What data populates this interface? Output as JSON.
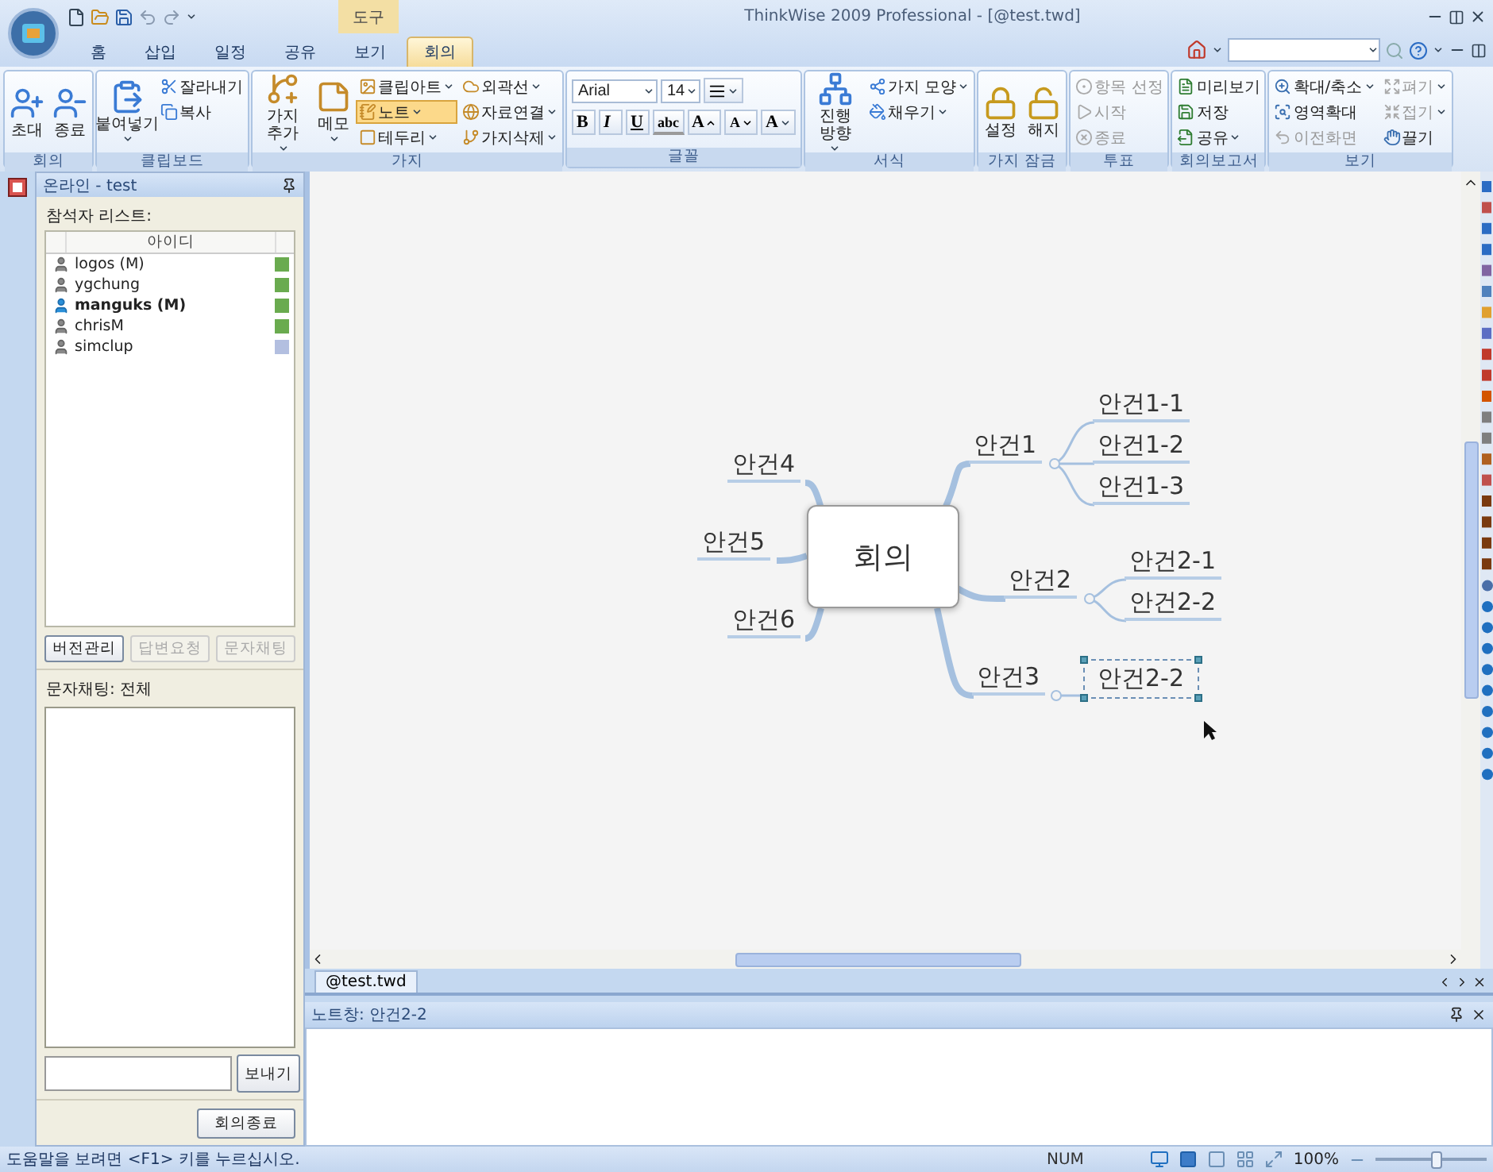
{
  "app": {
    "title": "ThinkWise 2009 Professional - [@test.twd]",
    "contextual_tab": "도구"
  },
  "tabs": [
    {
      "label": "홈",
      "selected": false
    },
    {
      "label": "삽입",
      "selected": false
    },
    {
      "label": "일정",
      "selected": false
    },
    {
      "label": "공유",
      "selected": false
    },
    {
      "label": "보기",
      "selected": false
    },
    {
      "label": "회의",
      "selected": true
    }
  ],
  "ribbon": [
    {
      "label": "회의",
      "kind": "buttons",
      "items": [
        {
          "kind": "large",
          "label": "초대",
          "dropdown": false,
          "disabled": false,
          "active": false
        },
        {
          "kind": "large",
          "label": "종료",
          "dropdown": false,
          "disabled": false,
          "active": false
        }
      ]
    },
    {
      "label": "클립보드",
      "kind": "buttons",
      "items": [
        {
          "kind": "large",
          "label": "붙여넣기",
          "dropdown": true,
          "disabled": false,
          "active": false
        },
        {
          "kind": "small",
          "label": "잘라내기",
          "dropdown": false,
          "disabled": false,
          "active": false
        },
        {
          "kind": "small",
          "label": "복사",
          "dropdown": false,
          "disabled": false,
          "active": false
        }
      ]
    },
    {
      "label": "가지",
      "kind": "buttons",
      "items": [
        {
          "kind": "large",
          "label": "가지 추가",
          "dropdown": true,
          "disabled": false,
          "active": false
        },
        {
          "kind": "large",
          "label": "메모",
          "dropdown": true,
          "disabled": false,
          "active": false
        },
        {
          "kind": "small",
          "label": "클립아트",
          "dropdown": true,
          "disabled": false,
          "active": false
        },
        {
          "kind": "small",
          "label": "노트",
          "dropdown": true,
          "disabled": false,
          "active": true
        },
        {
          "kind": "small",
          "label": "테두리",
          "dropdown": true,
          "disabled": false,
          "active": false
        },
        {
          "kind": "small",
          "label": "외곽선",
          "dropdown": true,
          "disabled": false,
          "active": false
        },
        {
          "kind": "small",
          "label": "자료연결",
          "dropdown": true,
          "disabled": false,
          "active": false
        },
        {
          "kind": "small",
          "label": "가지삭제",
          "dropdown": true,
          "disabled": false,
          "active": false
        }
      ]
    },
    {
      "label": "글꼴",
      "kind": "font",
      "font": "Arial",
      "size": "14",
      "format_buttons": [
        {
          "label": "B",
          "kind": "bold"
        },
        {
          "label": "I",
          "kind": "italic"
        },
        {
          "label": "U",
          "kind": "underline"
        },
        {
          "label": "abc",
          "kind": "strike"
        },
        {
          "label": "A",
          "kind": "grow"
        },
        {
          "label": "A",
          "kind": "shrink"
        },
        {
          "label": "A",
          "kind": "color"
        }
      ]
    },
    {
      "label": "서식",
      "kind": "buttons",
      "items": [
        {
          "kind": "large",
          "label": "진행 방향",
          "dropdown": true,
          "disabled": false,
          "active": false
        },
        {
          "kind": "small",
          "label": "가지 모양",
          "dropdown": true,
          "disabled": false,
          "active": false
        },
        {
          "kind": "small",
          "label": "채우기",
          "dropdown": true,
          "disabled": false,
          "active": false
        }
      ]
    },
    {
      "label": "가지 잠금",
      "kind": "buttons",
      "items": [
        {
          "kind": "large",
          "label": "설정",
          "dropdown": false,
          "disabled": false,
          "active": false
        },
        {
          "kind": "large",
          "label": "해지",
          "dropdown": false,
          "disabled": false,
          "active": false
        }
      ]
    },
    {
      "label": "투표",
      "kind": "buttons",
      "items": [
        {
          "kind": "small",
          "label": "항목 선정",
          "dropdown": false,
          "disabled": true,
          "active": false
        },
        {
          "kind": "small",
          "label": "시작",
          "dropdown": false,
          "disabled": true,
          "active": false
        },
        {
          "kind": "small",
          "label": "종료",
          "dropdown": false,
          "disabled": true,
          "active": false
        }
      ]
    },
    {
      "label": "회의보고서",
      "kind": "buttons",
      "items": [
        {
          "kind": "small",
          "label": "미리보기",
          "dropdown": false,
          "disabled": false,
          "active": false
        },
        {
          "kind": "small",
          "label": "저장",
          "dropdown": false,
          "disabled": false,
          "active": false
        },
        {
          "kind": "small",
          "label": "공유",
          "dropdown": true,
          "disabled": false,
          "active": false
        }
      ]
    },
    {
      "label": "보기",
      "kind": "buttons",
      "items": [
        {
          "kind": "small",
          "label": "확대/축소",
          "dropdown": true,
          "disabled": false,
          "active": false
        },
        {
          "kind": "small",
          "label": "영역확대",
          "dropdown": false,
          "disabled": false,
          "active": false
        },
        {
          "kind": "small",
          "label": "이전화면",
          "dropdown": false,
          "disabled": true,
          "active": false
        },
        {
          "kind": "small",
          "label": "펴기",
          "dropdown": true,
          "disabled": true,
          "active": false
        },
        {
          "kind": "small",
          "label": "접기",
          "dropdown": true,
          "disabled": true,
          "active": false
        },
        {
          "kind": "small",
          "label": "끌기",
          "dropdown": false,
          "disabled": false,
          "active": false
        }
      ]
    }
  ],
  "online_panel": {
    "title": "온라인 - test",
    "participants_label": "참석자 리스트:",
    "column": "아이디",
    "participants": [
      {
        "name": "logos (M)",
        "current": false,
        "color": "#6aab4f"
      },
      {
        "name": "ygchung",
        "current": false,
        "color": "#6aab4f"
      },
      {
        "name": "manguks (M)",
        "current": true,
        "color": "#6aab4f"
      },
      {
        "name": "chrisM",
        "current": false,
        "color": "#6aab4f"
      },
      {
        "name": "simclup",
        "current": false,
        "color": "#b3bfe0"
      }
    ],
    "buttons": [
      {
        "label": "버전관리",
        "disabled": false
      },
      {
        "label": "답변요청",
        "disabled": true
      },
      {
        "label": "문자채팅",
        "disabled": true
      }
    ],
    "chat_label": "문자채팅: 전체",
    "send_button": "보내기",
    "end_button": "회의종료"
  },
  "mind_map": {
    "center": "회의",
    "nodes": [
      {
        "label": "안건1",
        "selected": false,
        "children": [
          {
            "label": "안건1-1",
            "selected": false
          },
          {
            "label": "안건1-2",
            "selected": false
          },
          {
            "label": "안건1-3",
            "selected": false
          }
        ]
      },
      {
        "label": "안건2",
        "selected": false,
        "children": [
          {
            "label": "안건2-1",
            "selected": false
          },
          {
            "label": "안건2-2",
            "selected": false
          }
        ]
      },
      {
        "label": "안건3",
        "selected": false,
        "children": [
          {
            "label": "안건2-2",
            "selected": true
          }
        ]
      },
      {
        "label": "안건4",
        "selected": false
      },
      {
        "label": "안건5",
        "selected": false
      },
      {
        "label": "안건6",
        "selected": false
      }
    ]
  },
  "document_tab": "@test.twd",
  "notes": {
    "title": "노트창: 안건2-2"
  },
  "status_bar": {
    "message": "도움말을 보려면 <F1> 키를 누르십시오.",
    "num": "NUM",
    "zoom": "100%",
    "zoom_slider": {
      "level": 0.55
    }
  }
}
